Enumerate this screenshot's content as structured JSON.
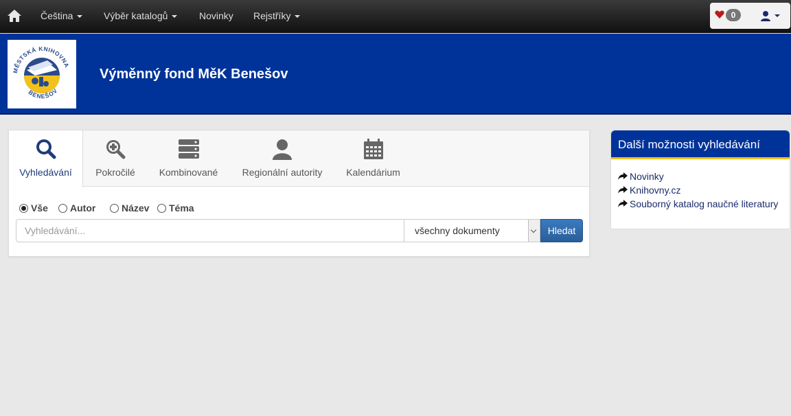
{
  "nav": {
    "home_icon": "home-icon",
    "items": [
      {
        "label": "Čeština",
        "dropdown": true
      },
      {
        "label": "Výběr katalogů",
        "dropdown": true
      },
      {
        "label": "Novinky",
        "dropdown": false
      },
      {
        "label": "Rejstříky",
        "dropdown": true
      }
    ],
    "favorites_count": "0",
    "favorites_icon": "heart-icon",
    "user_icon": "user-icon"
  },
  "banner": {
    "logo_text": "MĚSTSKÁ KNIHOVNA BENEŠOV",
    "title": "Výměnný fond MěK Benešov",
    "color": "#003399"
  },
  "search": {
    "tabs": [
      {
        "label": "Vyhledávání",
        "icon": "search-icon",
        "active": true
      },
      {
        "label": "Pokročilé",
        "icon": "zoom-plus-icon",
        "active": false
      },
      {
        "label": "Kombinované",
        "icon": "server-icon",
        "active": false
      },
      {
        "label": "Regionální autority",
        "icon": "person-icon",
        "active": false
      },
      {
        "label": "Kalendárium",
        "icon": "calendar-icon",
        "active": false
      }
    ],
    "radios": [
      {
        "label": "Vše",
        "checked": true
      },
      {
        "label": "Autor",
        "checked": false
      },
      {
        "label": "Název",
        "checked": false
      },
      {
        "label": "Téma",
        "checked": false
      }
    ],
    "input_placeholder": "Vyhledávání...",
    "input_value": "",
    "select_value": "všechny dokumenty",
    "button_label": "Hledat"
  },
  "side": {
    "title": "Další možnosti vyhledávání",
    "links": [
      {
        "label": "Novinky",
        "icon": "share-arrow-icon"
      },
      {
        "label": "Knihovny.cz",
        "icon": "share-arrow-icon"
      },
      {
        "label": "Souborný katalog naučné literatury",
        "icon": "share-arrow-icon"
      }
    ],
    "accent": "#f2c21b"
  }
}
